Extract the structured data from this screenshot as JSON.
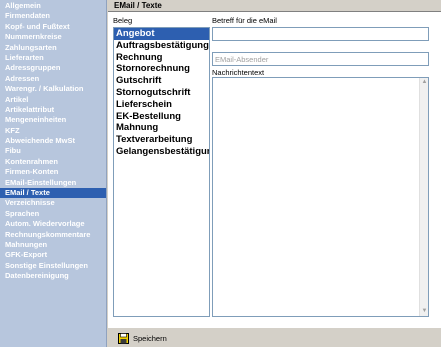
{
  "sidebar": {
    "items": [
      {
        "label": "Allgemein"
      },
      {
        "label": "Firmendaten"
      },
      {
        "label": "Kopf- und Fußtext"
      },
      {
        "label": "Nummernkreise"
      },
      {
        "label": "Zahlungsarten"
      },
      {
        "label": "Lieferarten"
      },
      {
        "label": "Adressgruppen"
      },
      {
        "label": "Adressen"
      },
      {
        "label": "Warengr. / Kalkulation"
      },
      {
        "label": "Artikel"
      },
      {
        "label": "Artikelattribut"
      },
      {
        "label": "Mengeneinheiten"
      },
      {
        "label": "KFZ"
      },
      {
        "label": "Abweichende MwSt"
      },
      {
        "label": "Fibu"
      },
      {
        "label": "Kontenrahmen"
      },
      {
        "label": "Firmen-Konten"
      },
      {
        "label": "EMail-Einstellungen"
      },
      {
        "label": "EMail / Texte"
      },
      {
        "label": "Verzeichnisse"
      },
      {
        "label": "Sprachen"
      },
      {
        "label": "Autom. Wiedervorlage"
      },
      {
        "label": "Rechnungskommentare"
      },
      {
        "label": "Mahnungen"
      },
      {
        "label": "GFK-Export"
      },
      {
        "label": "Sonstige Einstellungen"
      },
      {
        "label": "Datenbereinigung"
      }
    ],
    "active_index": 18
  },
  "header": {
    "title": "EMail / Texte"
  },
  "beleg": {
    "label": "Beleg",
    "items": [
      "Angebot",
      "Auftragsbestätigung",
      "Rechnung",
      "Stornorechnung",
      "Gutschrift",
      "Stornogutschrift",
      "Lieferschein",
      "EK-Bestellung",
      "Mahnung",
      "Textverarbeitung",
      "Gelangensbestätigung"
    ],
    "selected_index": 0
  },
  "form": {
    "betreff_label": "Betreff für die eMail",
    "betreff_value": "",
    "absender_placeholder": "EMail-Absender",
    "absender_value": "",
    "nachricht_label": "Nachrichtentext",
    "nachricht_value": ""
  },
  "footer": {
    "save_label": "Speichern"
  },
  "colors": {
    "sidebar_bg": "#b7c6dd",
    "selection": "#2d5fb0",
    "panel_bg": "#d4d0c8"
  }
}
